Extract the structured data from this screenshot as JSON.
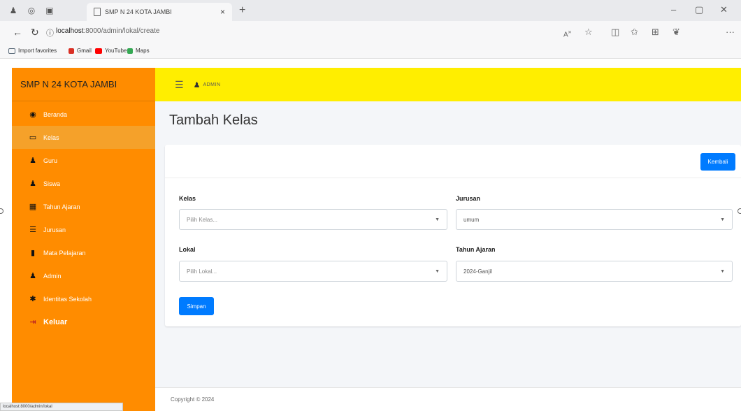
{
  "browser": {
    "tab_title": "SMP N 24 KOTA JAMBI",
    "tab_close": "×",
    "new_tab": "+",
    "url_host": "localhost",
    "url_path": ":8000/admin/lokal/create",
    "bookmarks": [
      {
        "label": "Import favorites",
        "color": "#5b6b7a"
      },
      {
        "label": "Gmail",
        "color": "#d93025"
      },
      {
        "label": "YouTube",
        "color": "#ff0000"
      },
      {
        "label": "Maps",
        "color": "#34a853"
      }
    ],
    "status_url": "localhost:8000/admin/lokal"
  },
  "sidebar": {
    "brand": "SMP N 24 KOTA JAMBI",
    "items": [
      {
        "label": "Beranda",
        "icon": "dashboard-icon",
        "glyph": "◉",
        "active": false
      },
      {
        "label": "Kelas",
        "icon": "class-icon",
        "glyph": "▭",
        "active": true
      },
      {
        "label": "Guru",
        "icon": "user-icon",
        "glyph": "♟",
        "active": false
      },
      {
        "label": "Siswa",
        "icon": "user-icon",
        "glyph": "♟",
        "active": false
      },
      {
        "label": "Tahun Ajaran",
        "icon": "calendar-icon",
        "glyph": "▦",
        "active": false
      },
      {
        "label": "Jurusan",
        "icon": "list-icon",
        "glyph": "☰",
        "active": false
      },
      {
        "label": "Mata Pelajaran",
        "icon": "book-icon",
        "glyph": "▮",
        "active": false
      },
      {
        "label": "Admin",
        "icon": "user-icon",
        "glyph": "♟",
        "active": false
      },
      {
        "label": "Identitas Sekolah",
        "icon": "gear-icon",
        "glyph": "✱",
        "active": false
      },
      {
        "label": "Keluar",
        "icon": "logout-icon",
        "glyph": "⇥",
        "active": false
      }
    ]
  },
  "topnav": {
    "user_label": "ADMIN"
  },
  "main": {
    "page_title": "Tambah Kelas",
    "back_button": "Kembali",
    "save_button": "Simpan",
    "fields": {
      "kelas": {
        "label": "Kelas",
        "value": "Pilih Kelas..."
      },
      "jurusan": {
        "label": "Jurusan",
        "value": "umum"
      },
      "lokal": {
        "label": "Lokal",
        "value": "Pilih Lokal..."
      },
      "tahun_ajaran": {
        "label": "Tahun Ajaran",
        "value": "2024-Ganjil"
      }
    }
  },
  "footer": {
    "text": "Copyright © 2024"
  },
  "colors": {
    "sidebar": "#ff8c00",
    "topnav": "#ffee00",
    "primary": "#007bff"
  }
}
